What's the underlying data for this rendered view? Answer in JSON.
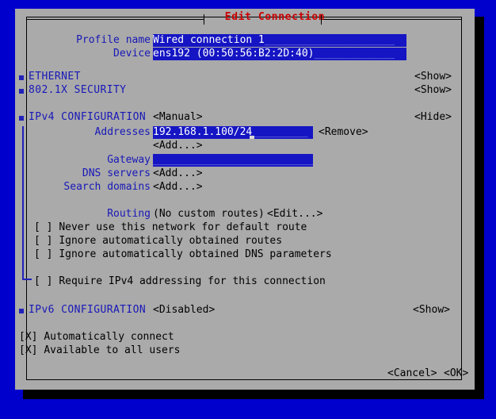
{
  "window": {
    "title": "Edit Connection",
    "title_color": "#cc0000",
    "background_color": "#0000cc",
    "dialog_color": "#aaaaaa",
    "accent_color": "#1818b8",
    "field_color": "#1515c4"
  },
  "form": {
    "profile_name": {
      "label": "Profile name",
      "value": "Wired connection 1",
      "fill": "_____________________"
    },
    "device": {
      "label": "Device",
      "value": "ens192 (00:50:56:B2:2D:40)",
      "fill": "_____________"
    }
  },
  "sections": [
    {
      "name": "ethernet",
      "label": "ETHERNET",
      "toggle": "<Show>"
    },
    {
      "name": "security-8021x",
      "label": "802.1X SECURITY",
      "toggle": "<Show>"
    },
    {
      "name": "ipv4-configuration",
      "label": "IPv4 CONFIGURATION",
      "mode": "<Manual>",
      "toggle": "<Hide>"
    },
    {
      "name": "ipv6-configuration",
      "label": "IPv6 CONFIGURATION",
      "mode": "<Disabled>",
      "toggle": "<Show>"
    }
  ],
  "ipv4": {
    "addresses": {
      "label": "Addresses",
      "value": "192.168.1.100/24",
      "fill": "_________",
      "remove_label": "<Remove>",
      "add_label": "<Add...>"
    },
    "gateway": {
      "label": "Gateway",
      "value": "",
      "fill": "___________________________"
    },
    "dns_servers": {
      "label": "DNS servers",
      "add_label": "<Add...>"
    },
    "search_domains": {
      "label": "Search domains",
      "add_label": "<Add...>"
    },
    "routing": {
      "label": "Routing",
      "status": "(No custom routes)",
      "edit_label": "<Edit...>"
    },
    "checkboxes": [
      {
        "name": "never-default-route",
        "mark": "[ ]",
        "label": "Never use this network for default route"
      },
      {
        "name": "ignore-auto-routes",
        "mark": "[ ]",
        "label": "Ignore automatically obtained routes"
      },
      {
        "name": "ignore-auto-dns",
        "mark": "[ ]",
        "label": "Ignore automatically obtained DNS parameters"
      },
      {
        "name": "require-ipv4",
        "mark": "[ ]",
        "label": "Require IPv4 addressing for this connection"
      }
    ]
  },
  "global_checkboxes": [
    {
      "name": "automatically-connect",
      "mark": "[X]",
      "label": "Automatically connect"
    },
    {
      "name": "available-to-all-users",
      "mark": "[X]",
      "label": "Available to all users"
    }
  ],
  "buttons": {
    "cancel": "<Cancel>",
    "ok": "<OK>"
  }
}
